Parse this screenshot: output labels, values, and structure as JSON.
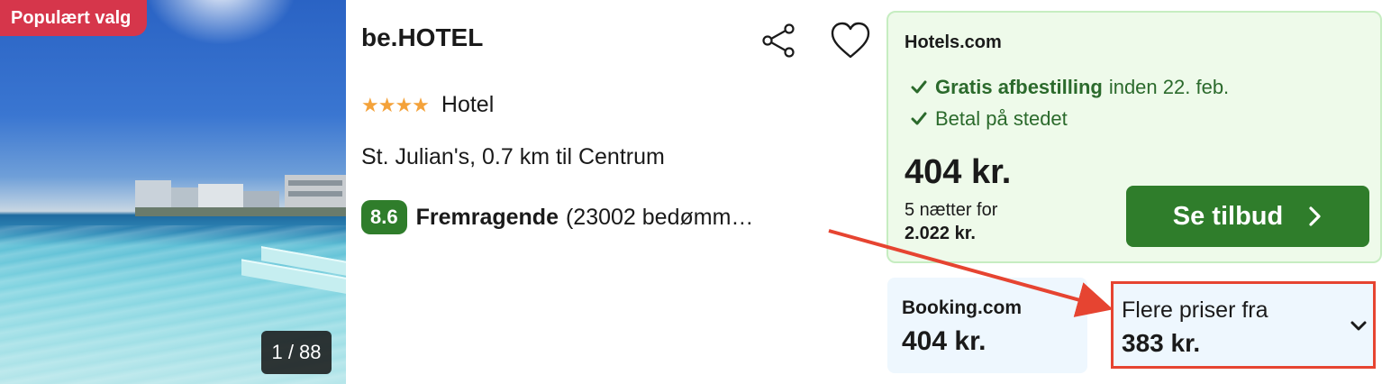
{
  "photo": {
    "badge": "Populært valg",
    "counter": "1 / 88"
  },
  "hotel": {
    "name": "be.HOTEL",
    "stars": "★★★★",
    "star_count": 4,
    "type": "Hotel",
    "location": "St. Julian's, 0.7 km til Centrum",
    "score": "8.6",
    "rating_word": "Fremragende",
    "reviews": "(23002 bedømm…"
  },
  "offer": {
    "provider": "Hotels.com",
    "benefit1_bold": "Gratis afbestilling",
    "benefit1_rest": "inden 22. feb.",
    "benefit2": "Betal på stedet",
    "price": "404 kr.",
    "nights_label": "5 nætter for",
    "total": "2.022 kr.",
    "cta": "Se tilbud"
  },
  "alt_offer": {
    "provider": "Booking.com",
    "price": "404 kr."
  },
  "more_prices": {
    "label": "Flere priser fra",
    "price": "383 kr."
  },
  "colors": {
    "accent_green": "#2f7d2b",
    "badge_red": "#d6364b",
    "annotation_red": "#e64431",
    "star_orange": "#f4a23a"
  },
  "icons": [
    "share-icon",
    "heart-icon",
    "check-icon",
    "chevron-right-icon",
    "chevron-down-icon"
  ]
}
